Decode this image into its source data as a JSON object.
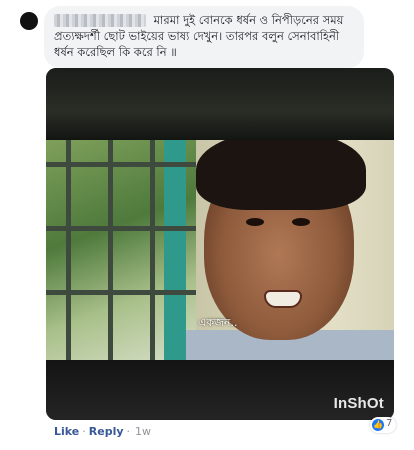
{
  "comment": {
    "text": "মারমা দুই বোনকে ধর্ষন ও নিপীড়নের সময় প্রত্যক্ষদর্শী ছোট ভাইয়ের ভাষ্য দেখুন। তারপর বলুন সেনাবাহিনী ধর্ষন করেছিল কি করে নি ॥"
  },
  "video": {
    "subtitle": "একজন..",
    "watermark": "InShOt"
  },
  "actions": {
    "like": "Like",
    "reply": "Reply",
    "time": "1w"
  },
  "reactions": {
    "icon": "thumbs-up-icon",
    "count": "7"
  },
  "colors": {
    "link": "#385898",
    "bubble": "#f2f3f5",
    "like_blue": "#1877f2"
  }
}
